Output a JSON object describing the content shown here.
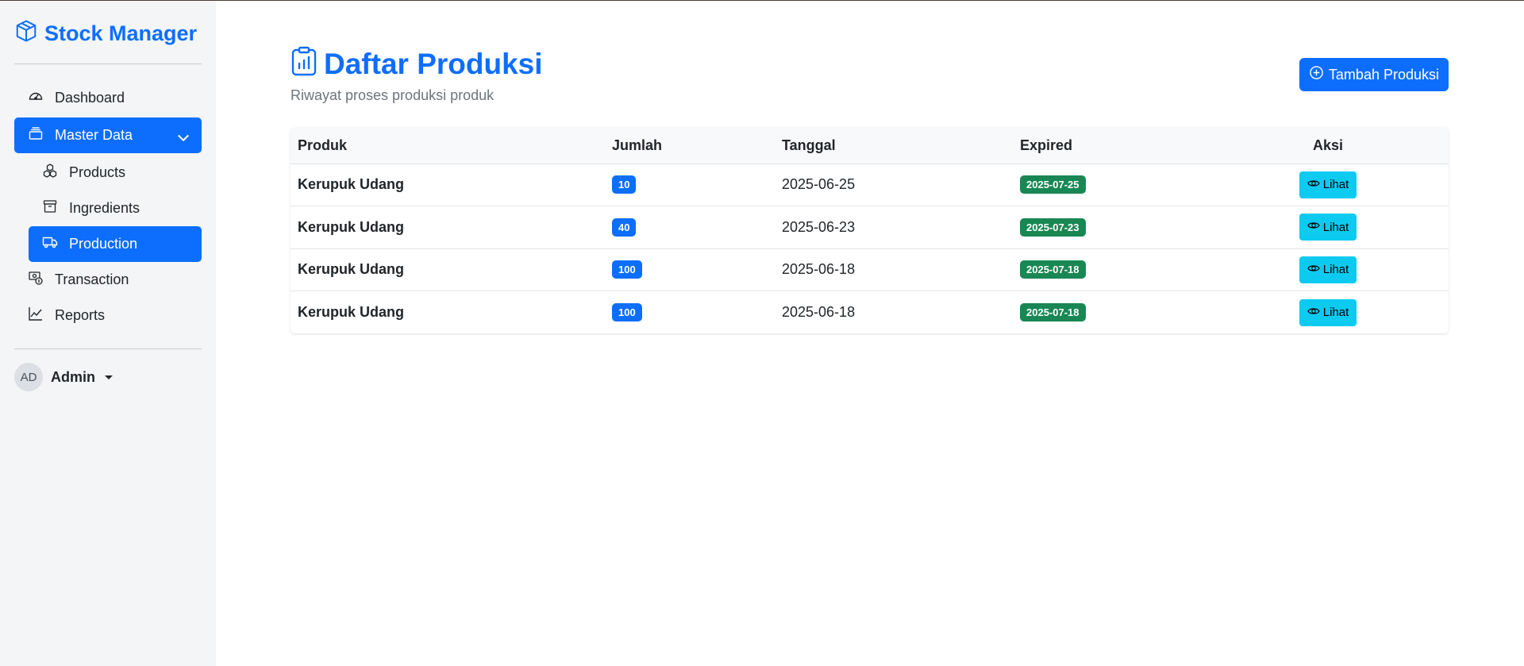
{
  "sidebar": {
    "brand": "Stock Manager",
    "items": [
      {
        "label": "Dashboard"
      },
      {
        "label": "Master Data"
      },
      {
        "label": "Products"
      },
      {
        "label": "Ingredients"
      },
      {
        "label": "Production"
      },
      {
        "label": "Transaction"
      },
      {
        "label": "Reports"
      }
    ],
    "user": {
      "initials": "AD",
      "name": "Admin"
    }
  },
  "header": {
    "title": "Daftar Produksi",
    "subtitle": "Riwayat proses produksi produk",
    "add_label": "Tambah Produksi"
  },
  "table": {
    "headers": [
      "Produk",
      "Jumlah",
      "Tanggal",
      "Expired",
      "Aksi"
    ],
    "rows": [
      {
        "produk": "Kerupuk Udang",
        "jumlah": "10",
        "tanggal": "2025-06-25",
        "expired": "2025-07-25",
        "aksi": "Lihat"
      },
      {
        "produk": "Kerupuk Udang",
        "jumlah": "40",
        "tanggal": "2025-06-23",
        "expired": "2025-07-23",
        "aksi": "Lihat"
      },
      {
        "produk": "Kerupuk Udang",
        "jumlah": "100",
        "tanggal": "2025-06-18",
        "expired": "2025-07-18",
        "aksi": "Lihat"
      },
      {
        "produk": "Kerupuk Udang",
        "jumlah": "100",
        "tanggal": "2025-06-18",
        "expired": "2025-07-18",
        "aksi": "Lihat"
      }
    ]
  },
  "colors": {
    "primary": "#0d6efd",
    "success": "#198754",
    "info": "#0dcaf0",
    "sidebar_bg": "#f3f5f7"
  }
}
